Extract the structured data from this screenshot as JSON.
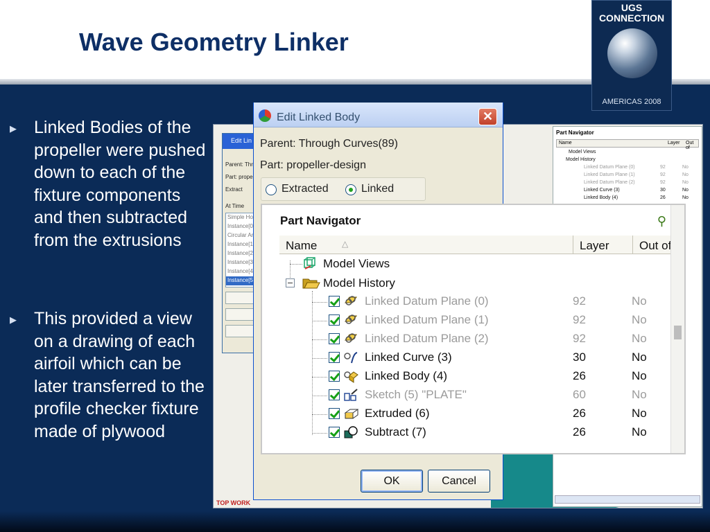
{
  "slide": {
    "title": "Wave Geometry Linker",
    "bullets": [
      "Linked Bodies of the propeller were pushed down to each of the fixture components and then subtracted from the extrusions",
      "This provided a view on a drawing of each airfoil which can be later transferred to the profile checker fixture made of plywood"
    ]
  },
  "logo": {
    "line1": "UGS",
    "line2": "CONNECTION",
    "tagline": "AMERICAS 2008"
  },
  "edit_dialog": {
    "title": "Edit Linked Body",
    "parent": "Parent: Through Curves(89)",
    "part": "Part: propeller-design",
    "radio_extracted": "Extracted",
    "radio_linked": "Linked",
    "selected": "Linked",
    "ok": "OK",
    "cancel": "Cancel",
    "close": "✕"
  },
  "part_navigator": {
    "title": "Part Navigator",
    "col_name": "Name",
    "col_layer": "Layer",
    "col_out": "Out of",
    "model_views": "Model Views",
    "model_history": "Model History",
    "items": [
      {
        "name": "Linked Datum Plane (0)",
        "layer": "92",
        "out": "No",
        "dimmed": true,
        "icon": "datum-plane-icon"
      },
      {
        "name": "Linked Datum Plane (1)",
        "layer": "92",
        "out": "No",
        "dimmed": true,
        "icon": "datum-plane-icon"
      },
      {
        "name": "Linked Datum Plane (2)",
        "layer": "92",
        "out": "No",
        "dimmed": true,
        "icon": "datum-plane-icon"
      },
      {
        "name": "Linked Curve (3)",
        "layer": "30",
        "out": "No",
        "dimmed": false,
        "icon": "linked-curve-icon"
      },
      {
        "name": "Linked Body (4)",
        "layer": "26",
        "out": "No",
        "dimmed": false,
        "icon": "linked-body-icon"
      },
      {
        "name": "Sketch (5) \"PLATE\"",
        "layer": "60",
        "out": "No",
        "dimmed": true,
        "icon": "sketch-icon"
      },
      {
        "name": "Extruded (6)",
        "layer": "26",
        "out": "No",
        "dimmed": false,
        "icon": "extrude-icon"
      },
      {
        "name": "Subtract (7)",
        "layer": "26",
        "out": "No",
        "dimmed": false,
        "icon": "subtract-icon"
      }
    ]
  },
  "background_dialog": {
    "title": "Edit Lin",
    "parent": "Parent: Thr",
    "part": "Part: prope",
    "radio": "Extract",
    "checkbox": "At Time",
    "list": [
      "Simple Ho",
      "Instance[0",
      "Circular Ar",
      "Instance[1",
      "Instance[2",
      "Instance[3",
      "Instance[4",
      "Instance[5"
    ],
    "footer": "TOP WORK"
  },
  "small_navigator": {
    "title": "Part Navigator",
    "col_name": "Name",
    "col_layer": "Layer",
    "col_out": "Out of",
    "model_views": "Model Views",
    "model_history": "Model History",
    "items": [
      {
        "name": "Linked Datum Plane (0)",
        "layer": "92",
        "out": "No",
        "dimmed": true
      },
      {
        "name": "Linked Datum Plane (1)",
        "layer": "92",
        "out": "No",
        "dimmed": true
      },
      {
        "name": "Linked Datum Plane (2)",
        "layer": "92",
        "out": "No",
        "dimmed": true
      },
      {
        "name": "Linked Curve (3)",
        "layer": "30",
        "out": "No",
        "dimmed": false
      },
      {
        "name": "Linked Body (4)",
        "layer": "26",
        "out": "No",
        "dimmed": false
      }
    ]
  },
  "colors": {
    "background": "#0b2b57",
    "title": "#0e2f66",
    "accent_green": "#16a016",
    "window_blue": "#0a4fd0"
  }
}
